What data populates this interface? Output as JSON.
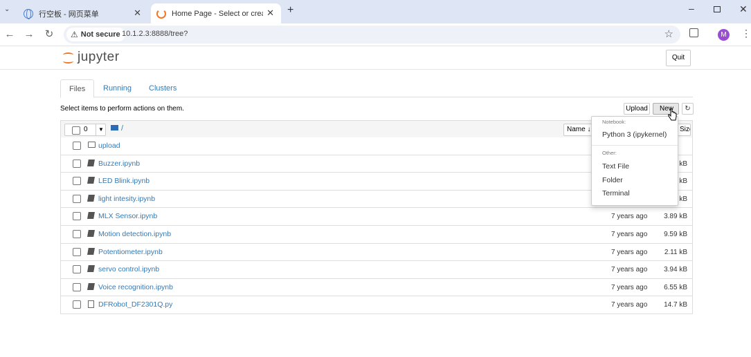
{
  "browser": {
    "tabs": [
      {
        "title": "行空板 - 网页菜单",
        "icon": "globe-icon"
      },
      {
        "title": "Home Page - Select or create a",
        "icon": "loading-spinner-icon"
      }
    ],
    "new_tab": "+",
    "security_label": "Not secure",
    "url": "10.1.2.3:8888/tree?",
    "profile_initial": "M"
  },
  "app": {
    "logo_text": "jupyter",
    "quit_label": "Quit",
    "tabs": [
      {
        "label": "Files"
      },
      {
        "label": "Running"
      },
      {
        "label": "Clusters"
      }
    ],
    "hint": "Select items to perform actions on them.",
    "upload_label": "Upload",
    "new_label": "New",
    "refresh_icon": "refresh-icon",
    "selected_count": "0",
    "breadcrumb": "/",
    "name_header": "Name",
    "size_header": "Size"
  },
  "files": [
    {
      "name": "upload",
      "type": "folder",
      "modified": "",
      "size": ""
    },
    {
      "name": "Buzzer.ipynb",
      "type": "notebook",
      "modified": "",
      "size": "kB"
    },
    {
      "name": "LED Blink.ipynb",
      "type": "notebook",
      "modified": "",
      "size": "kB"
    },
    {
      "name": "light intesity.ipynb",
      "type": "notebook",
      "modified": "",
      "size": "kB"
    },
    {
      "name": "MLX Sensor.ipynb",
      "type": "notebook",
      "modified": "7 years ago",
      "size": "3.89 kB"
    },
    {
      "name": "Motion detection.ipynb",
      "type": "notebook",
      "modified": "7 years ago",
      "size": "9.59 kB"
    },
    {
      "name": "Potentiometer.ipynb",
      "type": "notebook",
      "modified": "7 years ago",
      "size": "2.11 kB"
    },
    {
      "name": "servo control.ipynb",
      "type": "notebook",
      "modified": "7 years ago",
      "size": "3.94 kB"
    },
    {
      "name": "Voice recognition.ipynb",
      "type": "notebook",
      "modified": "7 years ago",
      "size": "6.55 kB"
    },
    {
      "name": "DFRobot_DF2301Q.py",
      "type": "file",
      "modified": "7 years ago",
      "size": "14.7 kB"
    }
  ],
  "new_menu": {
    "notebook_header": "Notebook:",
    "python_kernel": "Python 3 (ipykernel)",
    "other_header": "Other:",
    "text_file": "Text File",
    "folder": "Folder",
    "terminal": "Terminal"
  }
}
